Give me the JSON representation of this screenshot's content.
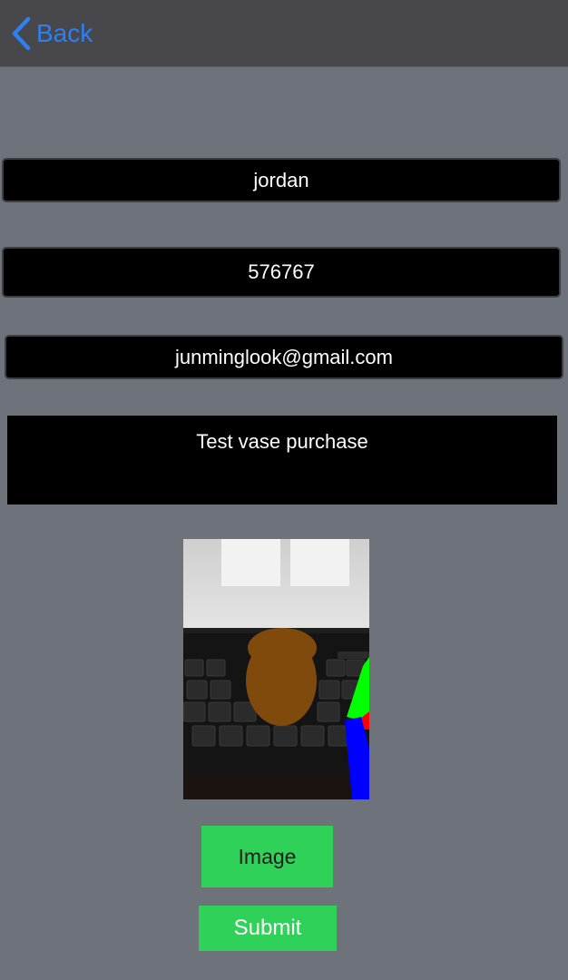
{
  "navbar": {
    "back_label": "Back"
  },
  "form": {
    "name_value": "jordan",
    "phone_value": "576767",
    "email_value": "junminglook@gmail.com",
    "description_value": "Test vase purchase"
  },
  "buttons": {
    "image_label": "Image",
    "submit_label": "Submit"
  },
  "colors": {
    "background": "#6e737b",
    "navbar": "#47474c",
    "accent_link": "#2f7ff1",
    "button_green": "#30d158"
  }
}
